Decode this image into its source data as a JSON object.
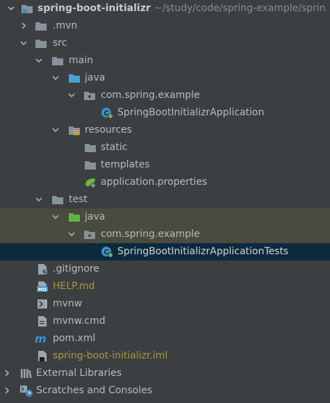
{
  "tree": {
    "root": {
      "label": "spring-boot-initializr",
      "path": "~/study/code/spring-example/sprin"
    },
    "mvn": "mvn",
    "src": "src",
    "main": "main",
    "java_main": "java",
    "pkg_main": "com.spring.example",
    "app_class": "SpringBootInitializrApplication",
    "resources": "resources",
    "static": "static",
    "templates": "templates",
    "app_props": "application.properties",
    "test": "test",
    "java_test": "java",
    "pkg_test": "com.spring.example",
    "test_class": "SpringBootInitializrApplicationTests",
    "gitignore": ".gitignore",
    "help": "HELP.md",
    "mvnw": "mvnw",
    "mvnw_cmd": "mvnw.cmd",
    "pom": "pom.xml",
    "iml": "spring-boot-initializr.iml",
    "ext_libs": "External Libraries",
    "scratches": "Scratches and Consoles"
  },
  "colors": {
    "background": "#3c3f41",
    "selection": "#0d293e",
    "test_highlight": "#474c3f",
    "folder": "#87939a",
    "source_folder": "#4a9fd7",
    "test_folder": "#62b543",
    "olive_text": "#a59b3c",
    "spring_green": "#6db33f"
  },
  "icons": {
    "folder": "folder-icon",
    "source_root": "source-root-folder-icon",
    "test_root": "test-root-folder-icon",
    "package": "package-icon",
    "class": "spring-class-icon",
    "resources": "resources-root-folder-icon",
    "properties": "spring-properties-icon",
    "text_file": "text-file-icon",
    "markdown": "markdown-file-icon",
    "shell": "shell-script-icon",
    "maven": "maven-icon",
    "iml": "module-file-icon",
    "libraries": "libraries-icon",
    "scratches": "scratches-icon",
    "project": "project-module-icon"
  }
}
